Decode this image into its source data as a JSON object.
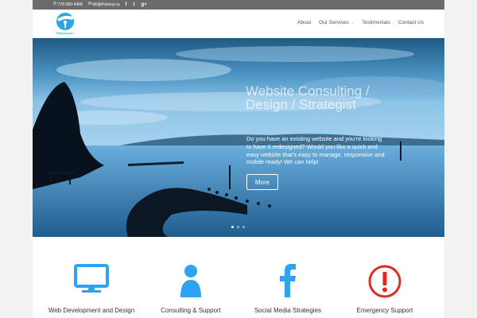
{
  "topbar": {
    "phone": "778-990-4468",
    "email": "bill@thisisny.ca",
    "social": [
      "f",
      "t",
      "g+"
    ]
  },
  "header": {
    "logo_text": "Thisisny.ca",
    "nav": [
      "About",
      "Our Services",
      "Testimonials",
      "Contact Us"
    ]
  },
  "hero": {
    "title": "Website Consulting / Design / Strategist",
    "description": "Do you have an existing website and you're looking to have it redesigned? Would you like a quick and easy website that's easy to manage, responsive and mobile ready!  We can help!",
    "button_label": "More",
    "slide_count": 3,
    "active_slide": 1
  },
  "services": [
    {
      "label": "Web Development and Design",
      "icon": "monitor-icon",
      "color": "#2ea3f2"
    },
    {
      "label": "Consulting & Support",
      "icon": "user-icon",
      "color": "#2ea3f2"
    },
    {
      "label": "Social Media Strategies",
      "icon": "facebook-icon",
      "color": "#2ea3f2"
    },
    {
      "label": "Emergency Support",
      "icon": "alert-icon",
      "color": "#e02b20"
    }
  ],
  "colors": {
    "accent": "#2ea3f2",
    "alert": "#e02b20",
    "topbar": "#6b6b6b"
  }
}
